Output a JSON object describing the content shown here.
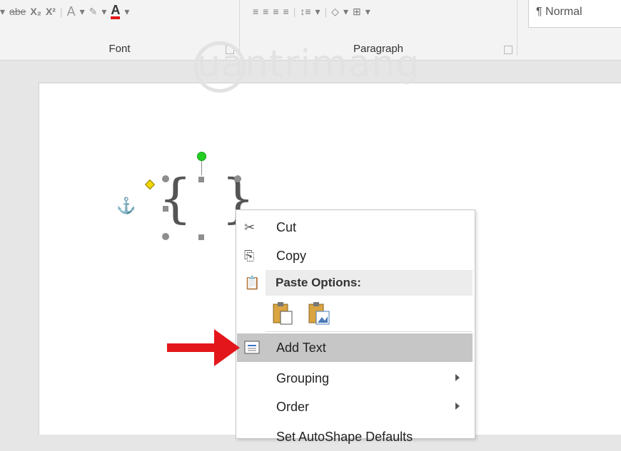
{
  "ribbon": {
    "font_group_label": "Font",
    "paragraph_group_label": "Paragraph",
    "style_name": "¶ Normal",
    "font_tools": [
      "abe",
      "X₂",
      "X²",
      "A",
      "A"
    ],
    "paragraph_tools": [
      "≡",
      "≡",
      "≡",
      "≡",
      "↕≡",
      "◇",
      "⊞"
    ]
  },
  "watermark": {
    "text": "uantrimang"
  },
  "context_menu": {
    "cut": "Cut",
    "copy": "Copy",
    "paste_options": "Paste Options:",
    "add_text": "Add Text",
    "grouping": "Grouping",
    "order": "Order",
    "set_default": "Set AutoShape Defaults"
  },
  "colors": {
    "highlight": "#c6c6c6",
    "arrow": "#e3171b",
    "rotation_handle": "#22d022",
    "anchor": "#3a72c8"
  }
}
